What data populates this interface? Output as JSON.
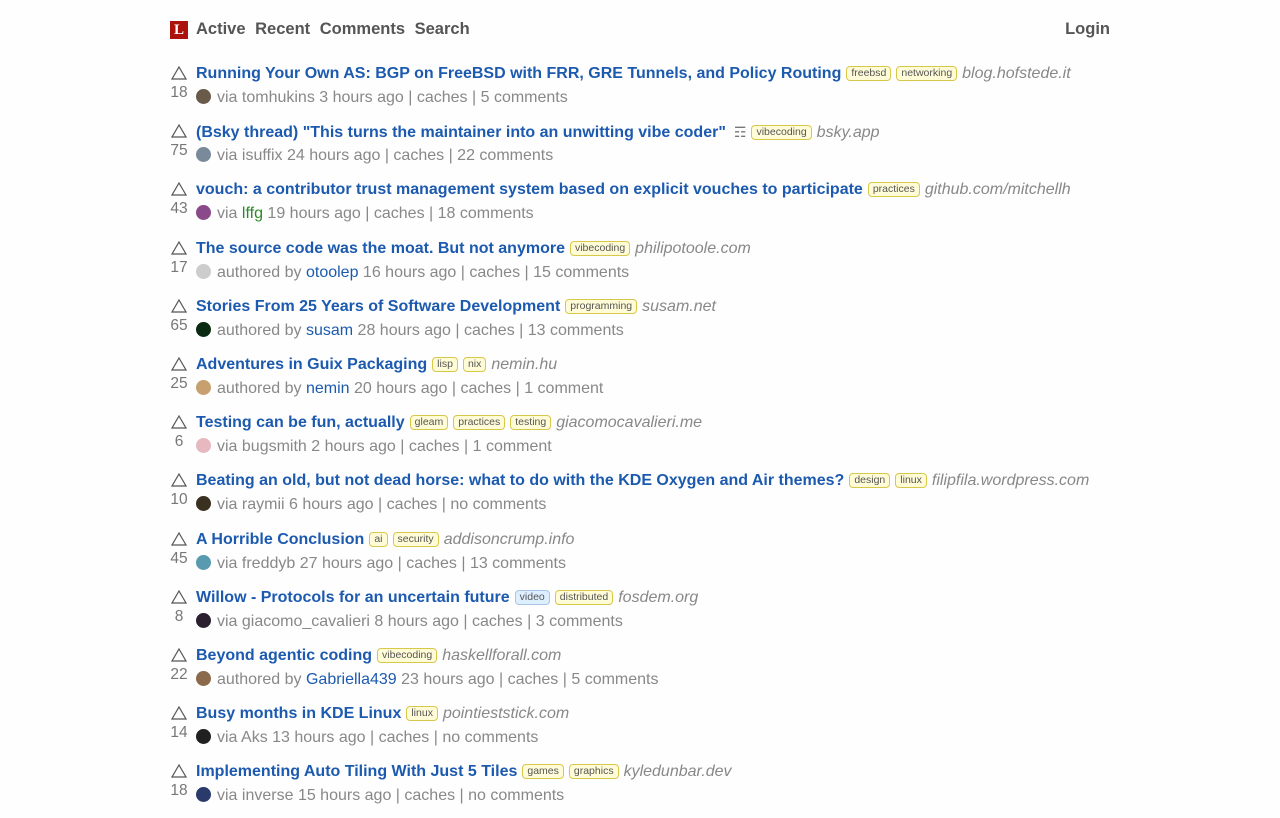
{
  "header": {
    "logo_letter": "L",
    "nav": [
      "Active",
      "Recent",
      "Comments",
      "Search"
    ],
    "login": "Login"
  },
  "stories": [
    {
      "title": "Running Your Own AS: BGP on FreeBSD with FRR, GRE Tunnels, and Policy Routing",
      "tags": [
        "freebsd",
        "networking"
      ],
      "domain": "blog.hofstede.it",
      "score": "18",
      "prefix": "via",
      "user": "tomhukins",
      "user_style": "normal",
      "time": "3 hours ago",
      "caches": "caches",
      "comments": "5 comments",
      "avatar": "#6a5a4a"
    },
    {
      "title": "(Bsky thread) \"This turns the maintainer into an unwitting vibe coder\"",
      "thread_icon": "☶",
      "tags": [
        "vibecoding"
      ],
      "domain": "bsky.app",
      "score": "75",
      "prefix": "via",
      "user": "isuffix",
      "user_style": "normal",
      "time": "24 hours ago",
      "caches": "caches",
      "comments": "22 comments",
      "avatar": "#7a8a9a"
    },
    {
      "title": "vouch: a contributor trust management system based on explicit vouches to participate",
      "tags": [
        "practices"
      ],
      "domain": "github.com/mitchellh",
      "score": "43",
      "prefix": "via",
      "user": "lffg",
      "user_style": "new",
      "time": "19 hours ago",
      "caches": "caches",
      "comments": "18 comments",
      "avatar": "#8a4a8a"
    },
    {
      "title": "The source code was the moat. But not anymore",
      "tags": [
        "vibecoding"
      ],
      "domain": "philipotoole.com",
      "score": "17",
      "prefix": "authored by",
      "user": "otoolep",
      "user_style": "author",
      "time": "16 hours ago",
      "caches": "caches",
      "comments": "15 comments",
      "avatar": "#cccccc"
    },
    {
      "title": "Stories From 25 Years of Software Development",
      "tags": [
        "programming"
      ],
      "domain": "susam.net",
      "score": "65",
      "prefix": "authored by",
      "user": "susam",
      "user_style": "author",
      "time": "28 hours ago",
      "caches": "caches",
      "comments": "13 comments",
      "avatar": "#0b2a12"
    },
    {
      "title": "Adventures in Guix Packaging",
      "tags": [
        "lisp",
        "nix"
      ],
      "domain": "nemin.hu",
      "score": "25",
      "prefix": "authored by",
      "user": "nemin",
      "user_style": "author",
      "time": "20 hours ago",
      "caches": "caches",
      "comments": "1 comment",
      "avatar": "#c8a070"
    },
    {
      "title": "Testing can be fun, actually",
      "tags": [
        "gleam",
        "practices",
        "testing"
      ],
      "domain": "giacomocavalieri.me",
      "score": "6",
      "prefix": "via",
      "user": "bugsmith",
      "user_style": "normal",
      "time": "2 hours ago",
      "caches": "caches",
      "comments": "1 comment",
      "avatar": "#e8b8c0"
    },
    {
      "title": "Beating an old, but not dead horse: what to do with the KDE Oxygen and Air themes?",
      "tags": [
        "design",
        "linux"
      ],
      "domain": "filipfila.wordpress.com",
      "score": "10",
      "prefix": "via",
      "user": "raymii",
      "user_style": "normal",
      "time": "6 hours ago",
      "caches": "caches",
      "comments": "no comments",
      "avatar": "#3a3020"
    },
    {
      "title": "A Horrible Conclusion",
      "tags": [
        "ai",
        "security"
      ],
      "domain": "addisoncrump.info",
      "score": "45",
      "prefix": "via",
      "user": "freddyb",
      "user_style": "normal",
      "time": "27 hours ago",
      "caches": "caches",
      "comments": "13 comments",
      "avatar": "#5a9ab0"
    },
    {
      "title": "Willow - Protocols for an uncertain future",
      "tags": [
        "video",
        "distributed"
      ],
      "media_tags": [
        "video"
      ],
      "domain": "fosdem.org",
      "score": "8",
      "prefix": "via",
      "user": "giacomo_cavalieri",
      "user_style": "normal",
      "time": "8 hours ago",
      "caches": "caches",
      "comments": "3 comments",
      "avatar": "#2a2030"
    },
    {
      "title": "Beyond agentic coding",
      "tags": [
        "vibecoding"
      ],
      "domain": "haskellforall.com",
      "score": "22",
      "prefix": "authored by",
      "user": "Gabriella439",
      "user_style": "author",
      "time": "23 hours ago",
      "caches": "caches",
      "comments": "5 comments",
      "avatar": "#8a6a4a"
    },
    {
      "title": "Busy months in KDE Linux",
      "tags": [
        "linux"
      ],
      "domain": "pointieststick.com",
      "score": "14",
      "prefix": "via",
      "user": "Aks",
      "user_style": "normal",
      "time": "13 hours ago",
      "caches": "caches",
      "comments": "no comments",
      "avatar": "#202020"
    },
    {
      "title": "Implementing Auto Tiling With Just 5 Tiles",
      "tags": [
        "games",
        "graphics"
      ],
      "domain": "kyledunbar.dev",
      "score": "18",
      "prefix": "via",
      "user": "inverse",
      "user_style": "normal",
      "time": "15 hours ago",
      "caches": "caches",
      "comments": "no comments",
      "avatar": "#2a3a6a"
    }
  ]
}
